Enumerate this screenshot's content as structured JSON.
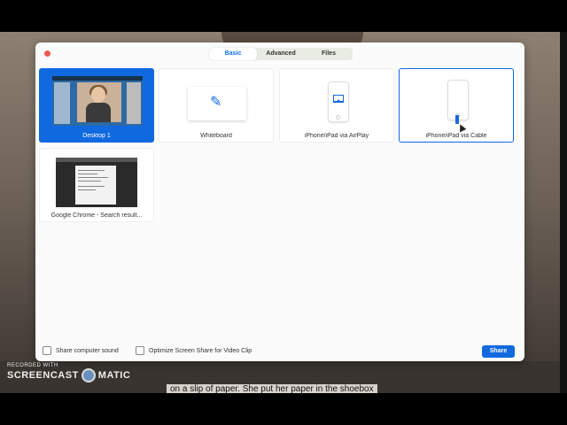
{
  "tabs": [
    {
      "label": "Basic",
      "active": true
    },
    {
      "label": "Advanced",
      "active": false
    },
    {
      "label": "Files",
      "active": false
    }
  ],
  "tiles": [
    {
      "label": "Desktop 1",
      "selected": true
    },
    {
      "label": "Whiteboard",
      "selected": false
    },
    {
      "label": "iPhone/iPad via AirPlay",
      "selected": false
    },
    {
      "label": "iPhone/iPad via Cable",
      "selected": false
    },
    {
      "label": "Google Chrome - Search result...",
      "selected": false
    }
  ],
  "footer": {
    "share_sound_label": "Share computer sound",
    "optimize_label": "Optimize Screen Share for Video Clip",
    "share_button": "Share"
  },
  "background_caption": "on a slip of paper. She put her paper in the shoebox",
  "watermark": {
    "line1": "RECORDED WITH",
    "brand_left": "SCREENCAST",
    "brand_right": "MATIC"
  },
  "colors": {
    "accent": "#1169e0",
    "close": "#ee5a52"
  },
  "icons": [
    "close-icon",
    "pen-icon",
    "airplay-icon",
    "phone-icon",
    "cable-icon",
    "checkbox-icon"
  ]
}
